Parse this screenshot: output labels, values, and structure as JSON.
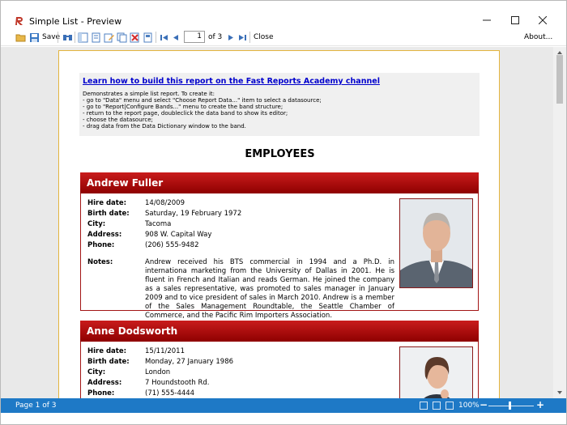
{
  "window": {
    "title": "Simple List - Preview",
    "controls": {
      "minimize": "—",
      "maximize": "☐",
      "close": "✕"
    }
  },
  "toolbar": {
    "save_label": "Save",
    "page_value": "1",
    "page_of": "of 3",
    "close_label": "Close",
    "about_label": "About..."
  },
  "report": {
    "info": {
      "link": "Learn how to build this report on the Fast Reports Academy channel",
      "lines": [
        "Demonstrates a simple list report. To create it:",
        "- go to \"Data\" menu and select \"Choose Report Data...\" item to select a datasource;",
        "- go to \"Report|Configure Bands...\" menu to create the band structure;",
        "- return to the report page, doubleclick the data band to show its editor;",
        "- choose the datasource;",
        "- drag data from the Data Dictionary window to the band."
      ]
    },
    "title": "EMPLOYEES",
    "labels": {
      "hire": "Hire date:",
      "birth": "Birth date:",
      "city": "City:",
      "address": "Address:",
      "phone": "Phone:",
      "notes": "Notes:"
    },
    "employees": [
      {
        "name": "Andrew Fuller",
        "hire_date": "14/08/2009",
        "birth_date": "Saturday, 19 February 1972",
        "city": "Tacoma",
        "address": "908 W. Capital Way",
        "phone": "(206) 555-9482",
        "notes": "Andrew received his BTS commercial in 1994 and a Ph.D. in internationa marketing from the University of Dallas in 2001. He is fluent in French and Italian and reads German. He joined the company as a sales representative, was promoted to sales manager in January 2009 and to vice president of sales in March 2010. Andrew is a member of the Sales Management Roundtable, the Seattle Chamber of Commerce, and the Pacific Rim Importers Association."
      },
      {
        "name": "Anne Dodsworth",
        "hire_date": "15/11/2011",
        "birth_date": "Monday, 27 January 1986",
        "city": "London",
        "address": "7 Houndstooth Rd.",
        "phone": "(71) 555-4444"
      }
    ]
  },
  "status": {
    "page_text": "Page 1 of 3",
    "zoom": "100%",
    "zoom_minus": "−",
    "zoom_plus": "+"
  },
  "colors": {
    "header_red": "#b01414",
    "status_blue": "#1e79c6",
    "link_blue": "#0000cc",
    "page_border": "#e3b43e"
  },
  "icons": [
    "app-icon",
    "open-icon",
    "save-icon",
    "find-icon",
    "outline-icon",
    "thumbnails-icon",
    "edit-icon",
    "copy-page-icon",
    "delete-page-icon",
    "page-setup-icon",
    "first-page-icon",
    "prev-page-icon",
    "next-page-icon",
    "last-page-icon"
  ]
}
